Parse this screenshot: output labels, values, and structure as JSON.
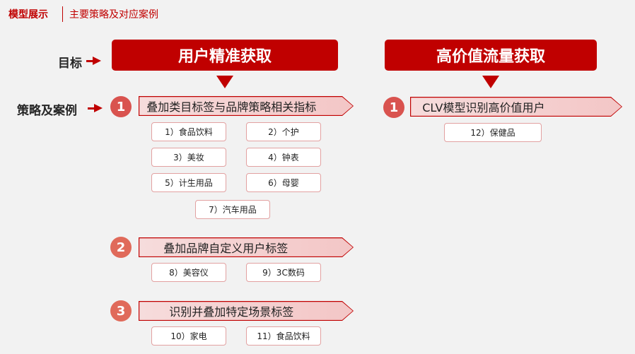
{
  "header": {
    "title": "模型展示",
    "subtitle": "主要策略及对应案例"
  },
  "labels": {
    "target": "目标",
    "strategy": "策略及案例"
  },
  "colors": {
    "accent": "#c00000",
    "circle_light": "#d9534f",
    "circle_mid": "#e06a5a"
  },
  "left": {
    "banner": "用户精准获取",
    "strategies": [
      {
        "number": "1",
        "label": "叠加类目标签与品牌策略相关指标",
        "cases": [
          "1）食品饮料",
          "2）个护",
          "3）美妆",
          "4）钟表",
          "5）计生用品",
          "6）母婴",
          "7）汽车用品"
        ]
      },
      {
        "number": "2",
        "label": "叠加品牌自定义用户标签",
        "cases": [
          "8）美容仪",
          "9）3C数码"
        ]
      },
      {
        "number": "3",
        "label": "识别并叠加特定场景标签",
        "cases": [
          "10）家电",
          "11）食品饮料"
        ]
      }
    ]
  },
  "right": {
    "banner": "高价值流量获取",
    "strategies": [
      {
        "number": "1",
        "label": "CLV模型识别高价值用户",
        "cases": [
          "12）保健品"
        ]
      }
    ]
  }
}
